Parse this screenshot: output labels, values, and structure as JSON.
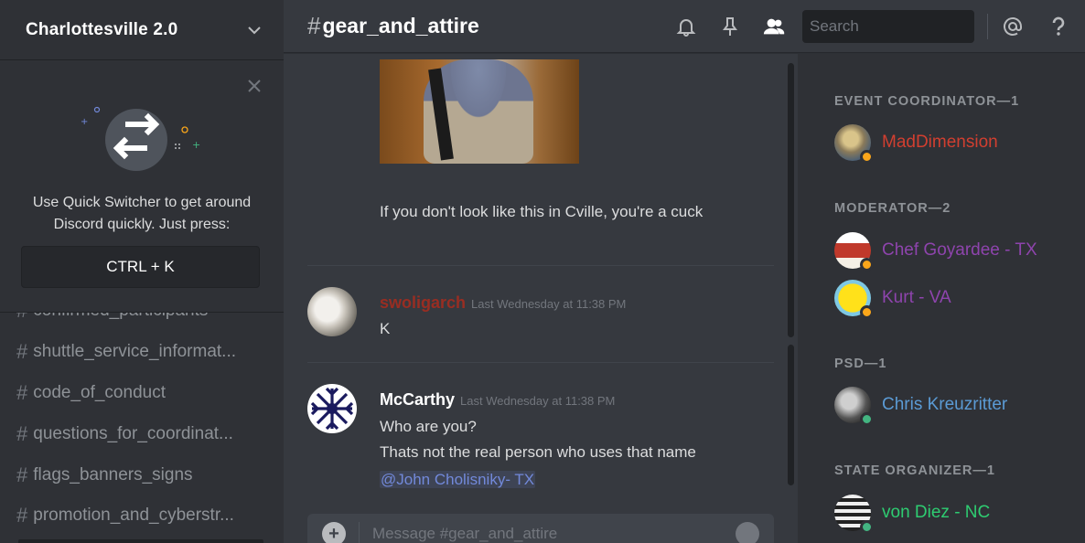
{
  "server": {
    "name": "Charlottesville 2.0"
  },
  "quick_switcher": {
    "text": "Use Quick Switcher to get around Discord quickly. Just press:",
    "shortcut": "CTRL + K"
  },
  "channels": [
    {
      "name": "confirmed_participants"
    },
    {
      "name": "shuttle_service_informat..."
    },
    {
      "name": "code_of_conduct"
    },
    {
      "name": "questions_for_coordinat..."
    },
    {
      "name": "flags_banners_signs"
    },
    {
      "name": "promotion_and_cyberstr..."
    }
  ],
  "channel_header": {
    "hash": "#",
    "title": "gear_and_attire"
  },
  "search": {
    "placeholder": "Search"
  },
  "messages": {
    "prev_text": "If you don't look like this in Cville, you're a cuck",
    "m1": {
      "author": "swoligarch",
      "author_color": "#992d22",
      "time": "Last Wednesday at 11:38 PM",
      "lines": [
        "K"
      ]
    },
    "m2": {
      "author": "McCarthy",
      "author_color": "#ffffff",
      "time": "Last Wednesday at 11:38 PM",
      "lines": [
        "Who are you?",
        "Thats not the real person who uses that name"
      ],
      "mention": "@John Cholisniky- TX"
    }
  },
  "composer": {
    "placeholder": "Message #gear_and_attire"
  },
  "members": {
    "groups": [
      {
        "role": "EVENT COORDINATOR—1",
        "people": [
          {
            "name": "MadDimension",
            "color": "#d13f30",
            "status": "#faa61a"
          }
        ]
      },
      {
        "role": "MODERATOR—2",
        "people": [
          {
            "name": "Chef Goyardee - TX",
            "color": "#8e44ad",
            "status": "#faa61a"
          },
          {
            "name": "Kurt - VA",
            "color": "#8e44ad",
            "status": "#faa61a"
          }
        ]
      },
      {
        "role": "PSD—1",
        "people": [
          {
            "name": "Chris Kreuzritter",
            "color": "#5b9bd5",
            "status": "#43b581"
          }
        ]
      },
      {
        "role": "STATE ORGANIZER—1",
        "people": [
          {
            "name": "von Diez - NC",
            "color": "#2ecc71",
            "status": "#43b581"
          }
        ]
      }
    ]
  }
}
